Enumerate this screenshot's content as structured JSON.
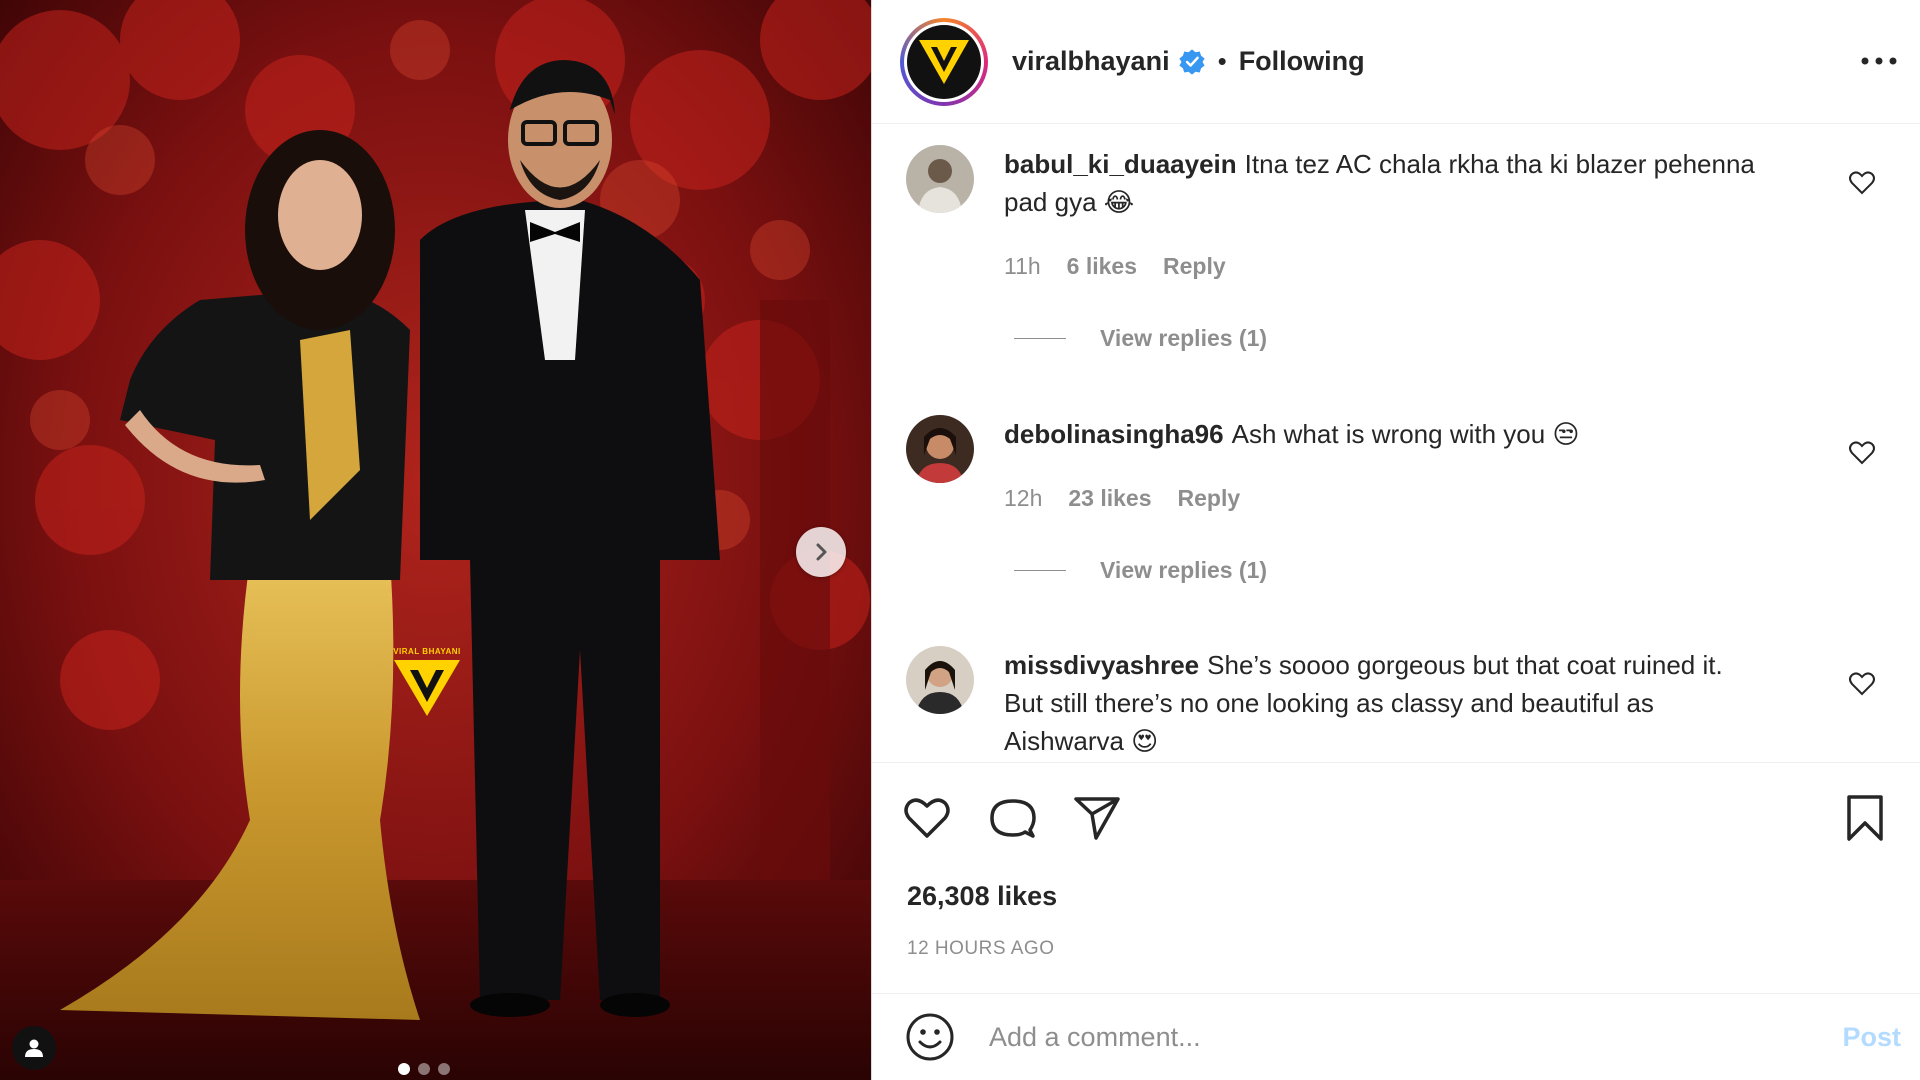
{
  "header": {
    "username": "viralbhayani",
    "separator": "•",
    "follow_status": "Following"
  },
  "media": {
    "watermark": "VIRAL BHAYANI",
    "carousel": {
      "current": 1,
      "total": 3
    }
  },
  "comments": [
    {
      "username": "babul_ki_duaayein",
      "text_line1": "Itna tez AC chala rkha tha ki blazer pehenna",
      "text_line2": "pad gya 😂",
      "time": "11h",
      "likes": "6 likes",
      "reply": "Reply",
      "view_replies": "View replies (1)"
    },
    {
      "username": "debolinasingha96",
      "text_line1": "Ash what is wrong with you 😒",
      "time": "12h",
      "likes": "23 likes",
      "reply": "Reply",
      "view_replies": "View replies (1)"
    },
    {
      "username": "missdivyashree",
      "text_line1": "She’s soooo gorgeous but that coat ruined it.",
      "text_line2": "But still there’s no one looking as classy and beautiful as",
      "text_line3": "Aishwarva 😍"
    }
  ],
  "actions": {
    "likes": "26,308 likes",
    "time_ago": "12 HOURS AGO"
  },
  "composer": {
    "placeholder": "Add a comment...",
    "post_label": "Post"
  },
  "icons": {
    "verified": "verified-badge-icon",
    "more": "more-options-icon",
    "like": "heart-icon",
    "comment": "comment-bubble-icon",
    "share": "paper-plane-icon",
    "save": "bookmark-icon",
    "emoji": "smiley-face-icon",
    "next": "chevron-right-icon",
    "tag": "user-tag-icon"
  },
  "colors": {
    "primary_text": "#262626",
    "secondary_text": "#8e8e8e",
    "verified_blue": "#3897f0",
    "post_disabled": "#b3dbff",
    "watermark_yellow": "#ffd200"
  }
}
